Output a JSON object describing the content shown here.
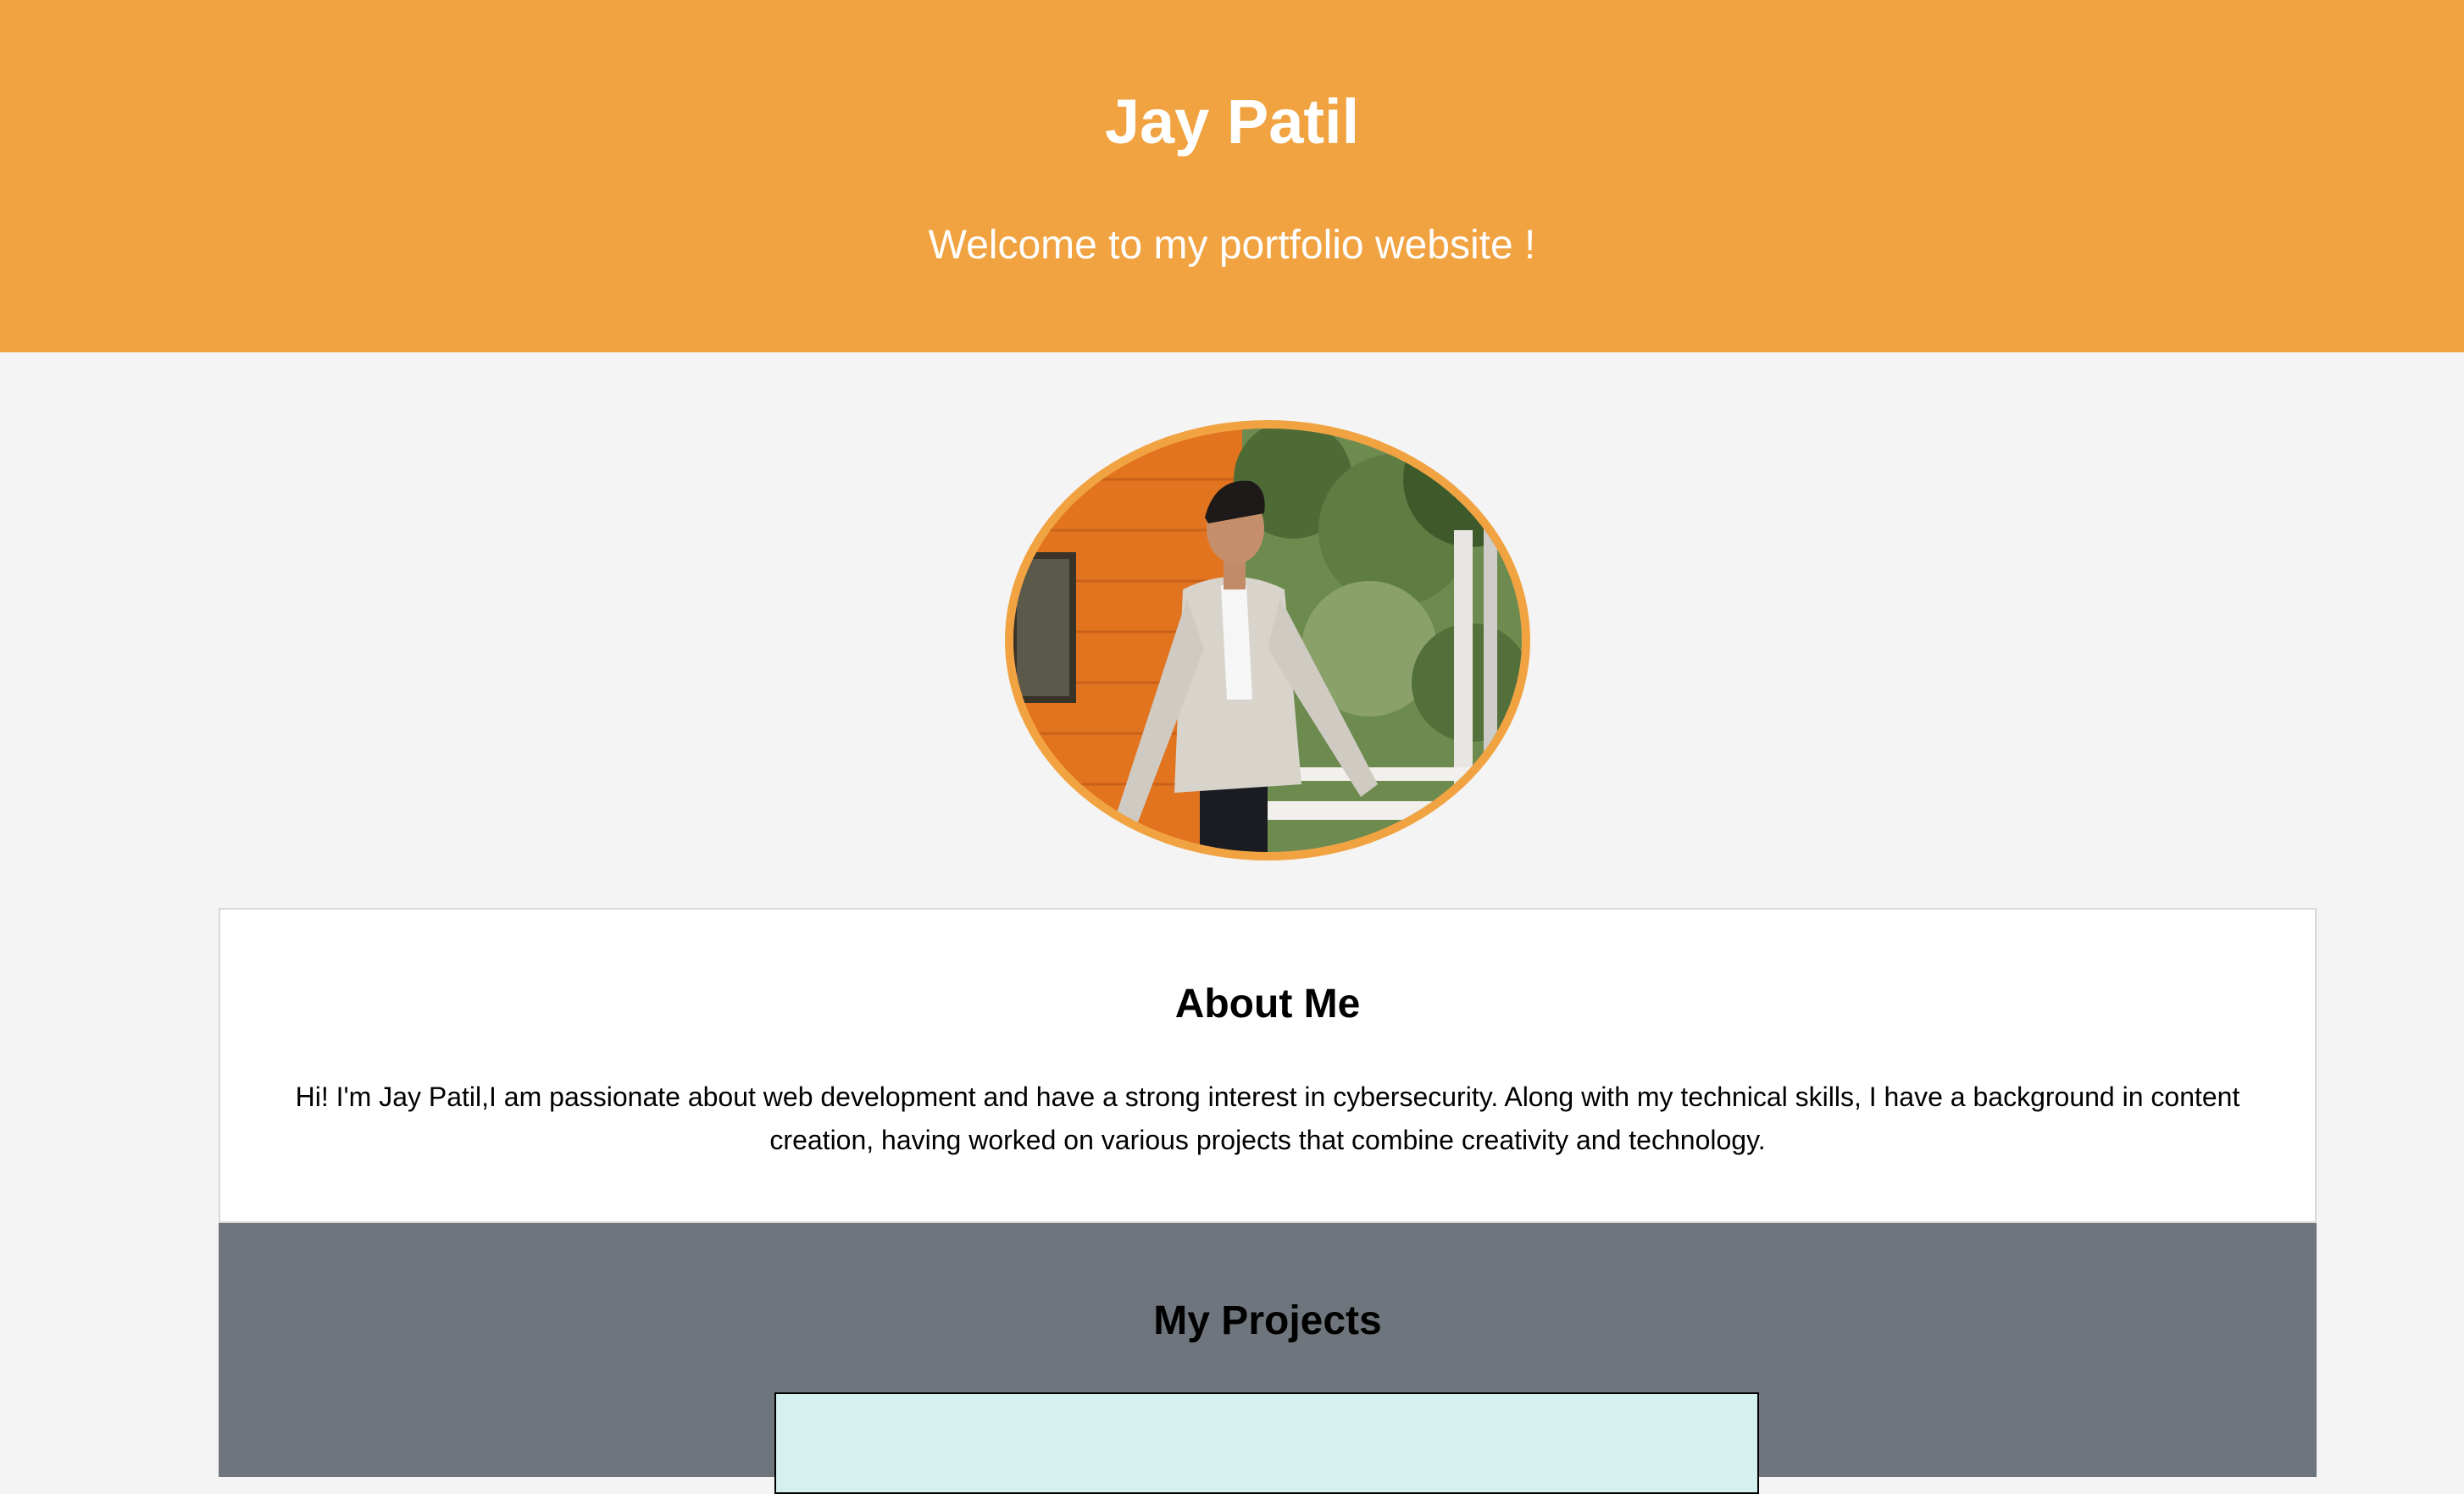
{
  "header": {
    "name": "Jay Patil",
    "tagline": "Welcome to my portfolio website !"
  },
  "colors": {
    "accent": "#f1a342",
    "page_background": "#f4f4f4",
    "projects_background": "#6f757d",
    "project_card_background": "#d4f1ef"
  },
  "about": {
    "title": "About Me",
    "text": "Hi! I'm Jay Patil,I am passionate about web development and have a strong interest in cybersecurity. Along with my technical skills, I have a background in content creation, having worked on various projects that combine creativity and technology."
  },
  "projects": {
    "title": "My Projects"
  }
}
